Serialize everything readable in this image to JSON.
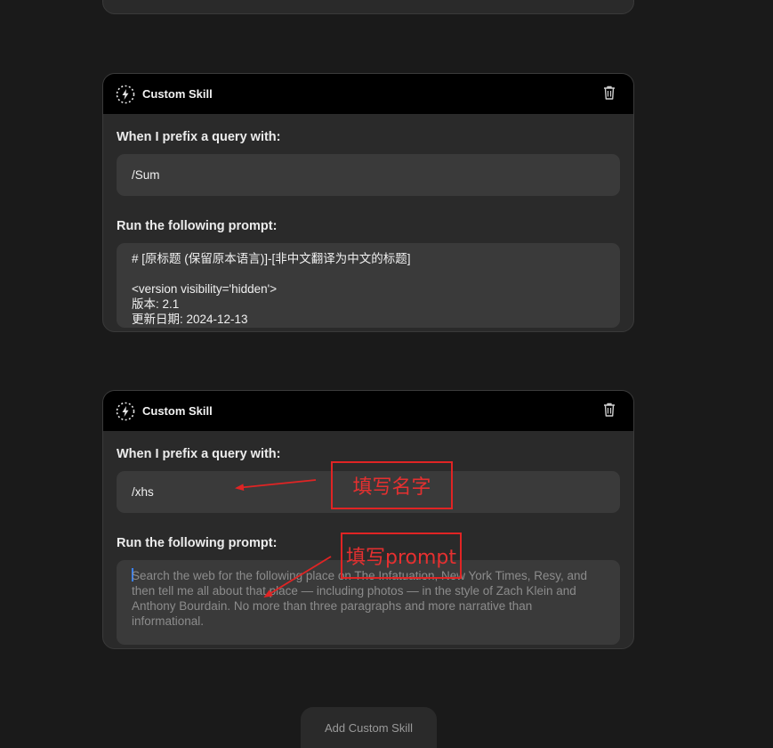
{
  "skills": [
    {
      "header_title": "Custom Skill",
      "prefix_label": "When I prefix a query with:",
      "prefix_value": "/Sum",
      "prompt_label": "Run the following prompt:",
      "prompt_value": "# [原标题 (保留原本语言)]-[非中文翻译为中文的标题]\n\n<version visibility='hidden'>\n版本: 2.1\n更新日期: 2024-12-13"
    },
    {
      "header_title": "Custom Skill",
      "prefix_label": "When I prefix a query with:",
      "prefix_value": "/xhs",
      "prompt_label": "Run the following prompt:",
      "prompt_placeholder": "Search the web for the following place on The Infatuation, New York Times, Resy, and then tell me all about that place — including photos — in the style of Zach Klein and Anthony Bourdain. No more than three paragraphs and more narrative than informational."
    }
  ],
  "add_button_label": "Add Custom Skill",
  "annotations": {
    "name_hint": "填写名字",
    "prompt_hint": "填写prompt",
    "color": "#e02424"
  },
  "icons": {
    "skill": "lightning-dashed-circle-icon",
    "delete": "trash-icon"
  }
}
